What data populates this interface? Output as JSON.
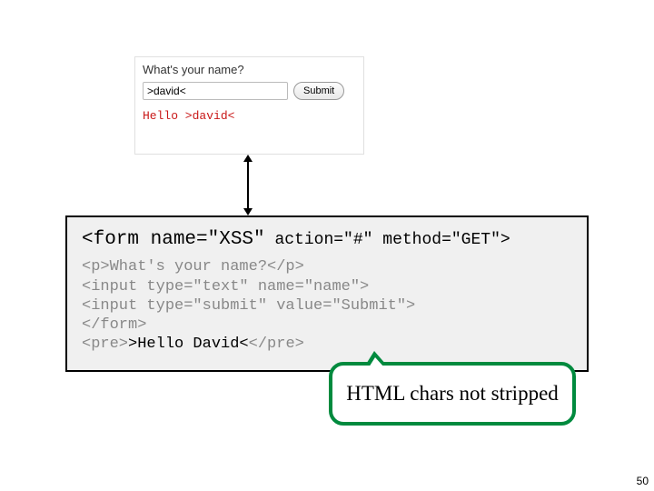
{
  "form": {
    "question": "What's your name?",
    "input_value": ">david<",
    "submit_label": "Submit",
    "output": "Hello >david<"
  },
  "code": {
    "line1_a": "<form name=\"XSS\"",
    "line1_b": " action=\"#\" method=\"GET\">",
    "line2": "<p>What's your name?</p>",
    "line3": "<input type=\"text\" name=\"name\">",
    "line4": "<input type=\"submit\" value=\"Submit\">",
    "line5": "</form>",
    "line6_a": "<pre>",
    "line6_b": ">Hello David<",
    "line6_c": "</pre>"
  },
  "callout": "HTML chars not stripped",
  "page_number": "50"
}
